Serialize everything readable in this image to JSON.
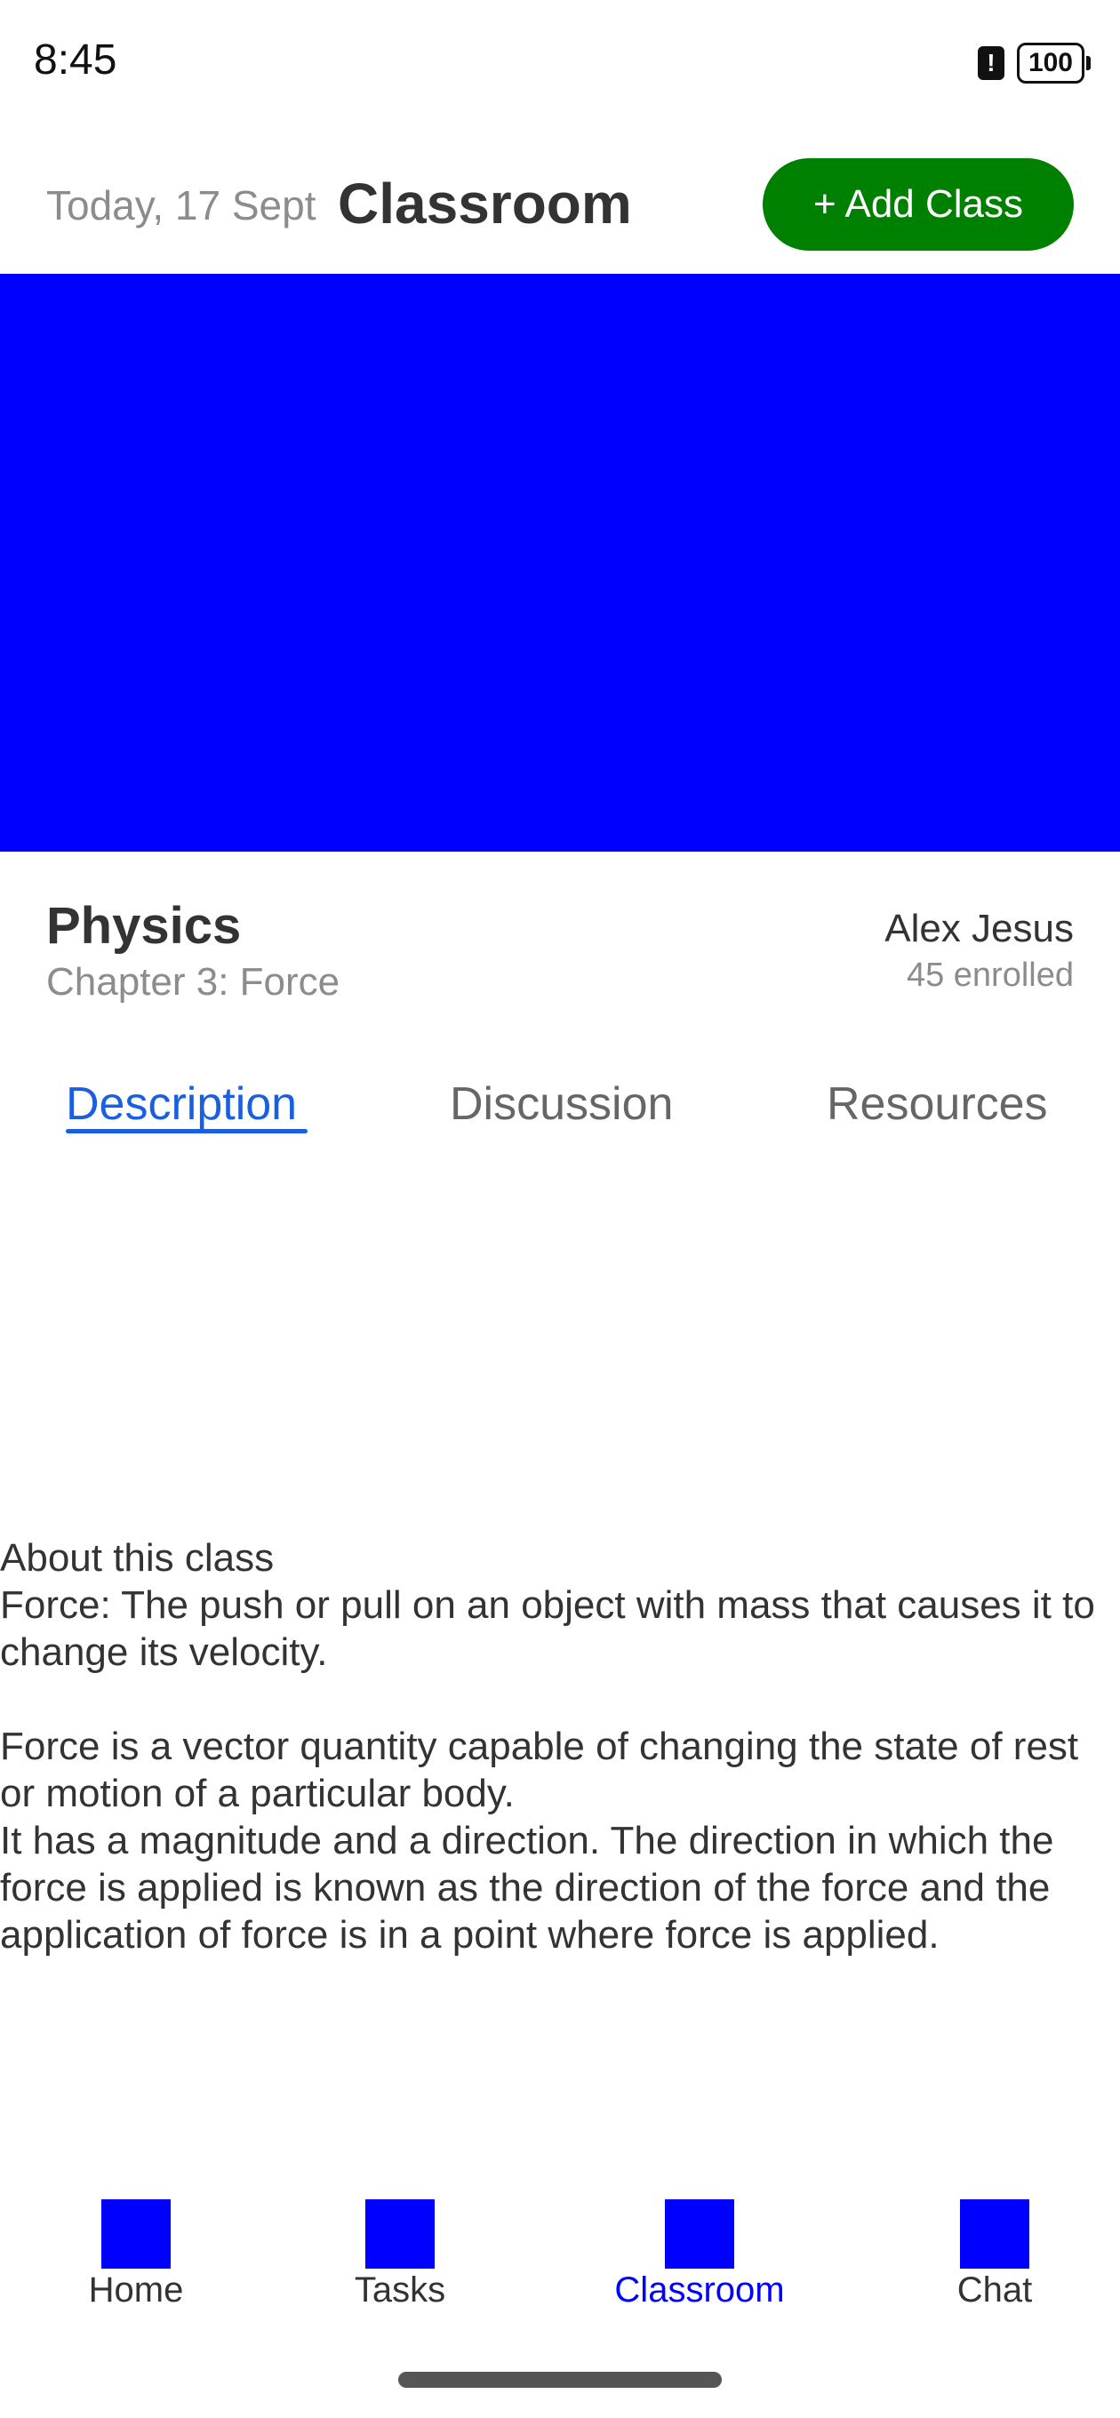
{
  "status_bar": {
    "time": "8:45",
    "alert_symbol": "!",
    "battery_level": "100",
    "icons": [
      "alert-icon",
      "battery-icon"
    ]
  },
  "header": {
    "date": "Today, 17 Sept",
    "title": "Classroom",
    "add_button_label": "+ Add Class",
    "add_button_color": "#008000"
  },
  "banner": {
    "color": "#0000ff"
  },
  "class_info": {
    "subject": "Physics",
    "chapter": "Chapter 3: Force",
    "teacher": "Alex Jesus",
    "enrolled": "45 enrolled"
  },
  "tabs": [
    {
      "label": "Description",
      "active": true
    },
    {
      "label": "Discussion",
      "active": false
    },
    {
      "label": "Resources",
      "active": false
    }
  ],
  "description": {
    "heading": "About this class",
    "body": "Force: The push or pull on an object with mass that causes it to change its velocity.\n\nForce is a vector quantity capable of changing the state of rest or motion of a particular body.\nIt has a magnitude and a direction. The direction in which the force is applied is known as the direction of the force and the application of force is in a point where force is applied."
  },
  "bottom_nav": {
    "items": [
      {
        "label": "Home",
        "icon": "home-icon",
        "active": false
      },
      {
        "label": "Tasks",
        "icon": "tasks-icon",
        "active": false
      },
      {
        "label": "Classroom",
        "icon": "classroom-icon",
        "active": true
      },
      {
        "label": "Chat",
        "icon": "chat-icon",
        "active": false
      }
    ],
    "active_color": "#0000ff"
  }
}
